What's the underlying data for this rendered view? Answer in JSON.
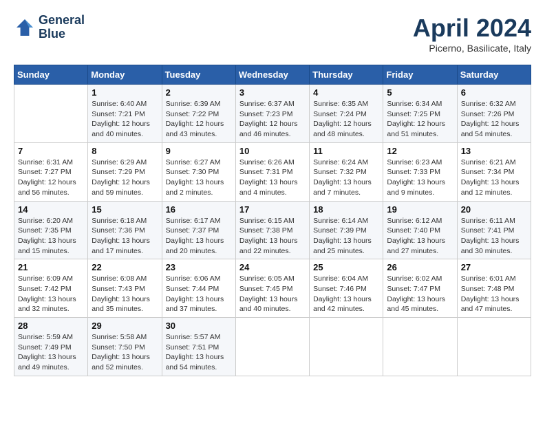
{
  "header": {
    "logo_line1": "General",
    "logo_line2": "Blue",
    "month": "April 2024",
    "location": "Picerno, Basilicate, Italy"
  },
  "days_of_week": [
    "Sunday",
    "Monday",
    "Tuesday",
    "Wednesday",
    "Thursday",
    "Friday",
    "Saturday"
  ],
  "weeks": [
    [
      {
        "num": "",
        "info": ""
      },
      {
        "num": "1",
        "info": "Sunrise: 6:40 AM\nSunset: 7:21 PM\nDaylight: 12 hours\nand 40 minutes."
      },
      {
        "num": "2",
        "info": "Sunrise: 6:39 AM\nSunset: 7:22 PM\nDaylight: 12 hours\nand 43 minutes."
      },
      {
        "num": "3",
        "info": "Sunrise: 6:37 AM\nSunset: 7:23 PM\nDaylight: 12 hours\nand 46 minutes."
      },
      {
        "num": "4",
        "info": "Sunrise: 6:35 AM\nSunset: 7:24 PM\nDaylight: 12 hours\nand 48 minutes."
      },
      {
        "num": "5",
        "info": "Sunrise: 6:34 AM\nSunset: 7:25 PM\nDaylight: 12 hours\nand 51 minutes."
      },
      {
        "num": "6",
        "info": "Sunrise: 6:32 AM\nSunset: 7:26 PM\nDaylight: 12 hours\nand 54 minutes."
      }
    ],
    [
      {
        "num": "7",
        "info": "Sunrise: 6:31 AM\nSunset: 7:27 PM\nDaylight: 12 hours\nand 56 minutes."
      },
      {
        "num": "8",
        "info": "Sunrise: 6:29 AM\nSunset: 7:29 PM\nDaylight: 12 hours\nand 59 minutes."
      },
      {
        "num": "9",
        "info": "Sunrise: 6:27 AM\nSunset: 7:30 PM\nDaylight: 13 hours\nand 2 minutes."
      },
      {
        "num": "10",
        "info": "Sunrise: 6:26 AM\nSunset: 7:31 PM\nDaylight: 13 hours\nand 4 minutes."
      },
      {
        "num": "11",
        "info": "Sunrise: 6:24 AM\nSunset: 7:32 PM\nDaylight: 13 hours\nand 7 minutes."
      },
      {
        "num": "12",
        "info": "Sunrise: 6:23 AM\nSunset: 7:33 PM\nDaylight: 13 hours\nand 9 minutes."
      },
      {
        "num": "13",
        "info": "Sunrise: 6:21 AM\nSunset: 7:34 PM\nDaylight: 13 hours\nand 12 minutes."
      }
    ],
    [
      {
        "num": "14",
        "info": "Sunrise: 6:20 AM\nSunset: 7:35 PM\nDaylight: 13 hours\nand 15 minutes."
      },
      {
        "num": "15",
        "info": "Sunrise: 6:18 AM\nSunset: 7:36 PM\nDaylight: 13 hours\nand 17 minutes."
      },
      {
        "num": "16",
        "info": "Sunrise: 6:17 AM\nSunset: 7:37 PM\nDaylight: 13 hours\nand 20 minutes."
      },
      {
        "num": "17",
        "info": "Sunrise: 6:15 AM\nSunset: 7:38 PM\nDaylight: 13 hours\nand 22 minutes."
      },
      {
        "num": "18",
        "info": "Sunrise: 6:14 AM\nSunset: 7:39 PM\nDaylight: 13 hours\nand 25 minutes."
      },
      {
        "num": "19",
        "info": "Sunrise: 6:12 AM\nSunset: 7:40 PM\nDaylight: 13 hours\nand 27 minutes."
      },
      {
        "num": "20",
        "info": "Sunrise: 6:11 AM\nSunset: 7:41 PM\nDaylight: 13 hours\nand 30 minutes."
      }
    ],
    [
      {
        "num": "21",
        "info": "Sunrise: 6:09 AM\nSunset: 7:42 PM\nDaylight: 13 hours\nand 32 minutes."
      },
      {
        "num": "22",
        "info": "Sunrise: 6:08 AM\nSunset: 7:43 PM\nDaylight: 13 hours\nand 35 minutes."
      },
      {
        "num": "23",
        "info": "Sunrise: 6:06 AM\nSunset: 7:44 PM\nDaylight: 13 hours\nand 37 minutes."
      },
      {
        "num": "24",
        "info": "Sunrise: 6:05 AM\nSunset: 7:45 PM\nDaylight: 13 hours\nand 40 minutes."
      },
      {
        "num": "25",
        "info": "Sunrise: 6:04 AM\nSunset: 7:46 PM\nDaylight: 13 hours\nand 42 minutes."
      },
      {
        "num": "26",
        "info": "Sunrise: 6:02 AM\nSunset: 7:47 PM\nDaylight: 13 hours\nand 45 minutes."
      },
      {
        "num": "27",
        "info": "Sunrise: 6:01 AM\nSunset: 7:48 PM\nDaylight: 13 hours\nand 47 minutes."
      }
    ],
    [
      {
        "num": "28",
        "info": "Sunrise: 5:59 AM\nSunset: 7:49 PM\nDaylight: 13 hours\nand 49 minutes."
      },
      {
        "num": "29",
        "info": "Sunrise: 5:58 AM\nSunset: 7:50 PM\nDaylight: 13 hours\nand 52 minutes."
      },
      {
        "num": "30",
        "info": "Sunrise: 5:57 AM\nSunset: 7:51 PM\nDaylight: 13 hours\nand 54 minutes."
      },
      {
        "num": "",
        "info": ""
      },
      {
        "num": "",
        "info": ""
      },
      {
        "num": "",
        "info": ""
      },
      {
        "num": "",
        "info": ""
      }
    ]
  ]
}
